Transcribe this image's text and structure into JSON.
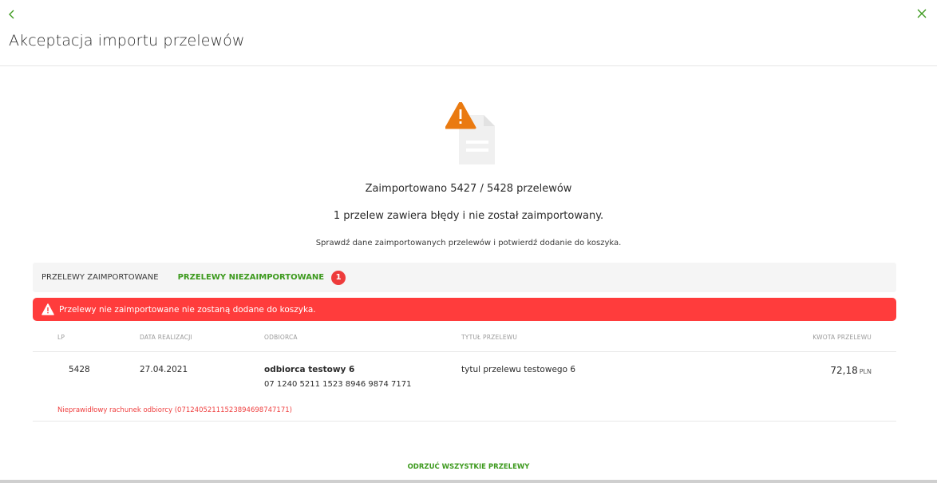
{
  "header": {
    "title": "Akceptacja importu przelewów",
    "back_icon": "chevron-left-icon",
    "close_icon": "close-icon",
    "accent_color": "#3d9a1e"
  },
  "summary": {
    "icon": "document-warning-icon",
    "imported_line": "Zaimportowano 5427 / 5428 przelewów",
    "error_line": "1 przelew zawiera błędy i nie został zaimportowany.",
    "hint": "Sprawdź dane zaimportowanych przelewów i potwierdź dodanie do koszyka."
  },
  "tabs": {
    "imported_label": "PRZELEWY ZAIMPORTOWANE",
    "not_imported_label": "PRZELEWY NIEZAIMPORTOWANE",
    "not_imported_count": "1",
    "active": "not_imported"
  },
  "alert": {
    "icon": "warning-icon",
    "text": "Przelewy nie zaimportowane nie zostaną dodane do koszyka.",
    "color": "#ff3c3c"
  },
  "table": {
    "headers": {
      "lp": "LP",
      "date": "DATA REALIZACJI",
      "recipient": "ODBIORCA",
      "title": "TYTUŁ PRZELEWU",
      "amount": "KWOTA PRZELEWU"
    },
    "rows": [
      {
        "lp": "5428",
        "date": "27.04.2021",
        "recipient_name": "odbiorca testowy 6",
        "recipient_account": "07 1240 5211 1523 8946 9874 7171",
        "title": "tytul przelewu testowego 6",
        "amount": "72,18",
        "currency": "PLN",
        "error": "Nieprawidłowy rachunek odbiorcy (07124052111523894698747171)"
      }
    ]
  },
  "actions": {
    "reject_all_label": "ODRZUĆ WSZYSTKIE PRZELEWY"
  }
}
